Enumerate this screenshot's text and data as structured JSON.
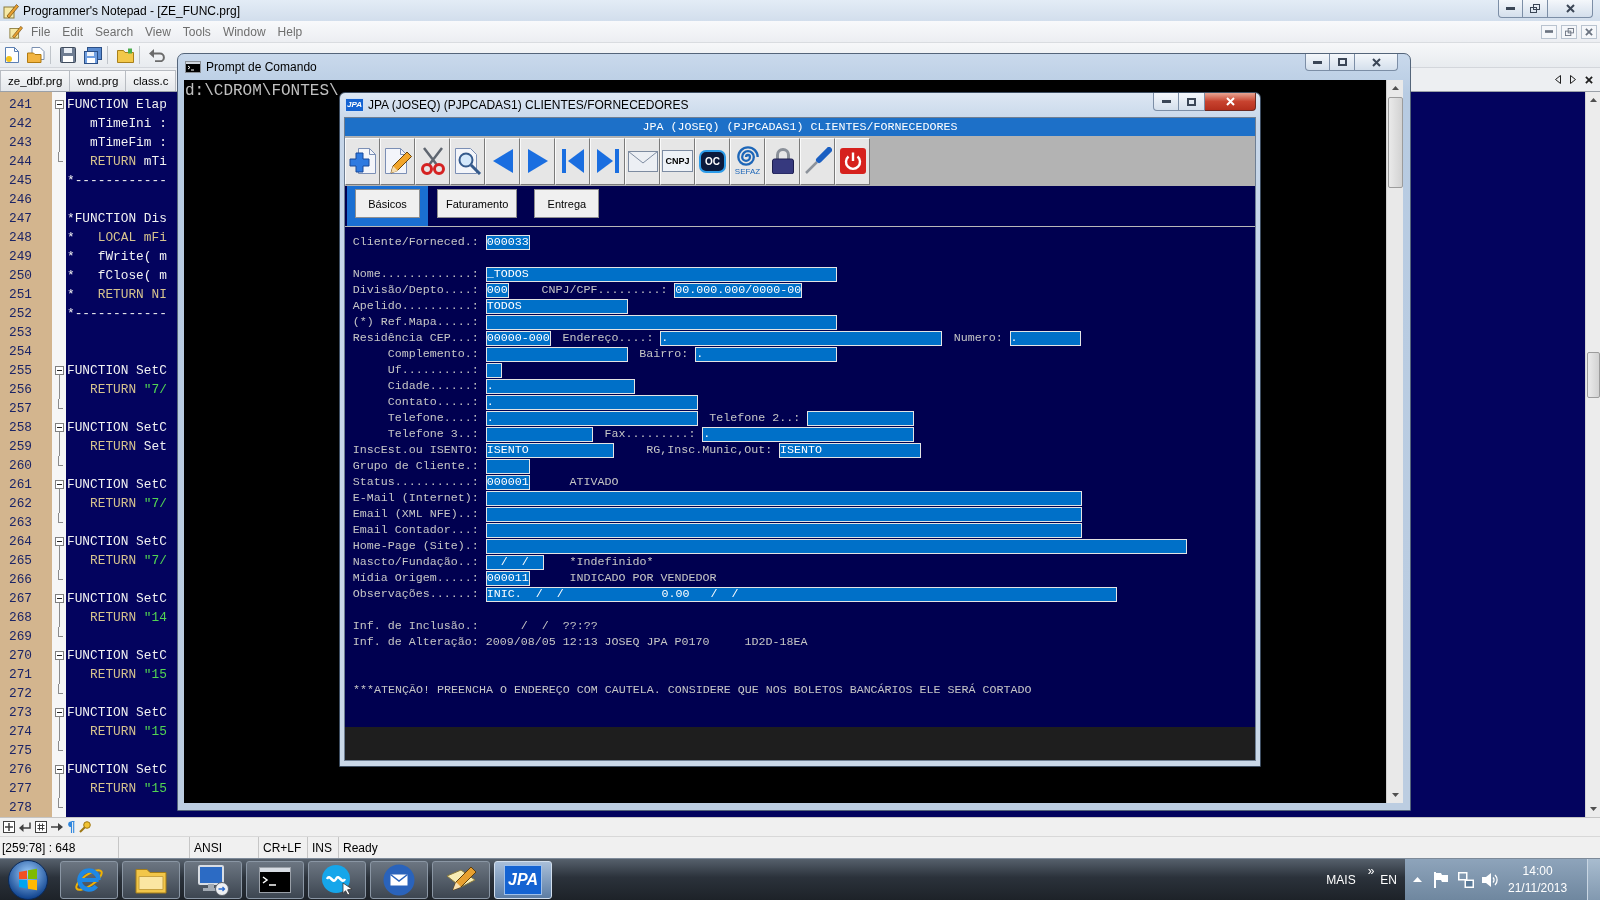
{
  "editor": {
    "title": "Programmer's Notepad - [ZE_FUNC.prg]",
    "menu": [
      "File",
      "Edit",
      "Search",
      "View",
      "Tools",
      "Window",
      "Help"
    ],
    "tabs": [
      {
        "label": "ze_dbf.prg",
        "selected": false
      },
      {
        "label": "wnd.prg",
        "selected": false
      },
      {
        "label": "class.c",
        "selected": false
      }
    ],
    "lines": [
      {
        "number": "241",
        "expanded": true,
        "tokens": [
          {
            "kind": "plain",
            "text": "FUNCTION Elap"
          }
        ],
        "children": [
          {
            "number": "242",
            "tokens": [
              {
                "kind": "plain",
                "text": "   mTimeIni :"
              }
            ]
          },
          {
            "number": "243",
            "tokens": [
              {
                "kind": "plain",
                "text": "   mTimeFim :"
              }
            ]
          },
          {
            "number": "244",
            "tokens": [
              {
                "kind": "keyword",
                "text": "   RETURN"
              },
              {
                "kind": "plain",
                "text": " mTi"
              }
            ]
          }
        ]
      },
      {
        "number": "245",
        "tokens": [
          {
            "kind": "plain",
            "text": "*------------"
          }
        ]
      },
      {
        "number": "246"
      },
      {
        "number": "247",
        "tokens": [
          {
            "kind": "plain",
            "text": "*FUNCTION Dis"
          }
        ]
      },
      {
        "number": "248",
        "tokens": [
          {
            "kind": "plain",
            "text": "*   "
          },
          {
            "kind": "keyword",
            "text": "LOCAL mFi"
          }
        ]
      },
      {
        "number": "249",
        "tokens": [
          {
            "kind": "plain",
            "text": "*   fWrite( m"
          }
        ]
      },
      {
        "number": "250",
        "tokens": [
          {
            "kind": "plain",
            "text": "*   fClose( m"
          }
        ]
      },
      {
        "number": "251",
        "tokens": [
          {
            "kind": "plain",
            "text": "*   "
          },
          {
            "kind": "keyword",
            "text": "RETURN NI"
          }
        ]
      },
      {
        "number": "252",
        "tokens": [
          {
            "kind": "plain",
            "text": "*------------"
          }
        ]
      },
      {
        "number": "253"
      },
      {
        "number": "254"
      },
      {
        "number": "255",
        "expanded": true,
        "tokens": [
          {
            "kind": "plain",
            "text": "FUNCTION SetC"
          }
        ],
        "children": [
          {
            "number": "256",
            "tokens": [
              {
                "kind": "keyword",
                "text": "   RETURN"
              },
              {
                "kind": "string",
                "text": " \"7/"
              }
            ]
          },
          {
            "number": "257"
          }
        ]
      },
      {
        "number": "258",
        "expanded": true,
        "tokens": [
          {
            "kind": "plain",
            "text": "FUNCTION SetC"
          }
        ],
        "children": [
          {
            "number": "259",
            "tokens": [
              {
                "kind": "keyword",
                "text": "   RETURN"
              },
              {
                "kind": "plain",
                "text": " Set"
              }
            ]
          },
          {
            "number": "260"
          }
        ]
      },
      {
        "number": "261",
        "expanded": true,
        "tokens": [
          {
            "kind": "plain",
            "text": "FUNCTION SetC"
          }
        ],
        "children": [
          {
            "number": "262",
            "tokens": [
              {
                "kind": "keyword",
                "text": "   RETURN"
              },
              {
                "kind": "string",
                "text": " \"7/"
              }
            ]
          },
          {
            "number": "263"
          }
        ]
      },
      {
        "number": "264",
        "expanded": true,
        "tokens": [
          {
            "kind": "plain",
            "text": "FUNCTION SetC"
          }
        ],
        "children": [
          {
            "number": "265",
            "tokens": [
              {
                "kind": "keyword",
                "text": "   RETURN"
              },
              {
                "kind": "string",
                "text": " \"7/"
              }
            ]
          },
          {
            "number": "266"
          }
        ]
      },
      {
        "number": "267",
        "expanded": true,
        "tokens": [
          {
            "kind": "plain",
            "text": "FUNCTION SetC"
          }
        ],
        "children": [
          {
            "number": "268",
            "tokens": [
              {
                "kind": "keyword",
                "text": "   RETURN"
              },
              {
                "kind": "string",
                "text": " \"14"
              }
            ]
          },
          {
            "number": "269"
          }
        ]
      },
      {
        "number": "270",
        "expanded": true,
        "tokens": [
          {
            "kind": "plain",
            "text": "FUNCTION SetC"
          }
        ],
        "children": [
          {
            "number": "271",
            "tokens": [
              {
                "kind": "keyword",
                "text": "   RETURN"
              },
              {
                "kind": "string",
                "text": " \"15"
              }
            ]
          },
          {
            "number": "272"
          }
        ]
      },
      {
        "number": "273",
        "expanded": true,
        "tokens": [
          {
            "kind": "plain",
            "text": "FUNCTION SetC"
          }
        ],
        "children": [
          {
            "number": "274",
            "tokens": [
              {
                "kind": "keyword",
                "text": "   RETURN"
              },
              {
                "kind": "string",
                "text": " \"15"
              }
            ]
          },
          {
            "number": "275"
          }
        ]
      },
      {
        "number": "276",
        "expanded": true,
        "tokens": [
          {
            "kind": "plain",
            "text": "FUNCTION SetC"
          }
        ],
        "children": [
          {
            "number": "277",
            "tokens": [
              {
                "kind": "keyword",
                "text": "   RETURN"
              },
              {
                "kind": "string",
                "text": " \"15"
              }
            ]
          },
          {
            "number": "278"
          }
        ]
      }
    ],
    "status_bar": {
      "position": "[259:78] : 648",
      "encoding": "ANSI",
      "line_ending": "CR+LF",
      "mode": "INS",
      "state": "Ready"
    }
  },
  "command_prompt": {
    "title": "Prompt de Comando",
    "lines": [
      "d:\\CDROM\\FONTES\\"
    ]
  },
  "jpa_window": {
    "icon_label": "JPA",
    "title": "JPA (JOSEQ) (PJPCADAS1) CLIENTES/FORNECEDORES",
    "header": "JPA (JOSEQ) (PJPCADAS1) CLIENTES/FORNECEDORES",
    "toolbar": [
      {
        "kind": "add"
      },
      {
        "kind": "edit"
      },
      {
        "kind": "cut"
      },
      {
        "kind": "preview"
      },
      {
        "kind": "previous"
      },
      {
        "kind": "next"
      },
      {
        "kind": "first"
      },
      {
        "kind": "last"
      },
      {
        "kind": "mail"
      },
      {
        "kind": "card",
        "label": "CNPJ"
      },
      {
        "kind": "bubble",
        "label": "OC"
      },
      {
        "kind": "swirl",
        "label": "SEFAZ"
      },
      {
        "kind": "lock"
      },
      {
        "kind": "tool"
      },
      {
        "kind": "power"
      }
    ],
    "tabs": [
      {
        "label": "Básicos",
        "selected": true
      },
      {
        "label": "Faturamento",
        "selected": false
      },
      {
        "label": "Entrega",
        "selected": false
      }
    ],
    "form": [
      {
        "rows": [
          {
            "label": "Cliente/Forneced.:",
            "items": [
              {
                "kind": "field",
                "value": "000033"
              }
            ]
          }
        ]
      },
      {
        "rows": [
          {
            "label": "Nome.............:",
            "items": [
              {
                "kind": "field",
                "value": "_TODOS"
              }
            ]
          },
          {
            "label": "Divisão/Depto....:",
            "items": [
              {
                "kind": "field",
                "value": "000"
              },
              {
                "kind": "text",
                "text": "CNPJ/CPF.........:"
              },
              {
                "kind": "field",
                "value": "00.000.000/0000-00"
              }
            ]
          },
          {
            "label": "Apelido..........:",
            "items": [
              {
                "kind": "field",
                "value": "TODOS"
              }
            ]
          },
          {
            "label": "(*) Ref.Mapa.....:",
            "items": [
              {
                "kind": "field"
              }
            ]
          },
          {
            "label": "Residência CEP...:",
            "items": [
              {
                "kind": "field",
                "value": "00000-000"
              },
              {
                "kind": "text",
                "text": "Endereço....:"
              },
              {
                "kind": "field",
                "value": "."
              },
              {
                "kind": "text",
                "text": "Numero:"
              },
              {
                "kind": "field",
                "value": "."
              }
            ]
          },
          {
            "label": "Complemento.:",
            "items": [
              {
                "kind": "field"
              },
              {
                "kind": "text",
                "text": "Bairro:"
              },
              {
                "kind": "field",
                "value": "."
              }
            ]
          },
          {
            "label": "Uf..........:",
            "items": [
              {
                "kind": "field"
              }
            ]
          },
          {
            "label": "Cidade......:",
            "items": [
              {
                "kind": "field",
                "value": "."
              }
            ]
          },
          {
            "label": "Contato.....:",
            "items": [
              {
                "kind": "field",
                "value": "."
              }
            ]
          },
          {
            "label": "Telefone....:",
            "items": [
              {
                "kind": "field",
                "value": "."
              },
              {
                "kind": "text",
                "text": "Telefone 2..:"
              },
              {
                "kind": "field"
              }
            ]
          },
          {
            "label": "Telefone 3..:",
            "items": [
              {
                "kind": "field"
              },
              {
                "kind": "text",
                "text": "Fax.........:"
              },
              {
                "kind": "field",
                "value": "."
              }
            ]
          },
          {
            "label": "InscEst.ou ISENTO:",
            "items": [
              {
                "kind": "field",
                "value": "ISENTO"
              },
              {
                "kind": "text",
                "text": "RG,Insc.Munic,Out:"
              },
              {
                "kind": "field",
                "value": "ISENTO"
              }
            ]
          },
          {
            "label": "Grupo de Cliente.:",
            "items": [
              {
                "kind": "field"
              }
            ]
          },
          {
            "label": "Status...........:",
            "items": [
              {
                "kind": "field",
                "value": "000001"
              },
              {
                "kind": "text",
                "text": "ATIVADO"
              }
            ]
          },
          {
            "label": "E-Mail (Internet):",
            "items": [
              {
                "kind": "field"
              }
            ]
          },
          {
            "label": "Email (XML NFE)..:",
            "items": [
              {
                "kind": "field"
              }
            ]
          },
          {
            "label": "Email Contador...:",
            "items": [
              {
                "kind": "field"
              }
            ]
          },
          {
            "label": "Home-Page (Site).:",
            "items": [
              {
                "kind": "field"
              }
            ]
          },
          {
            "label": "Nascto/Fundação..:",
            "items": [
              {
                "kind": "field",
                "value": "  /  /"
              },
              {
                "kind": "text",
                "text": "*Indefinido*"
              }
            ]
          },
          {
            "label": "Mídia Origem.....:",
            "items": [
              {
                "kind": "field",
                "value": "000011"
              },
              {
                "kind": "text",
                "text": "INDICADO POR VENDEDOR"
              }
            ]
          },
          {
            "label": "Observações......:",
            "items": [
              {
                "kind": "field",
                "value": "INIC.  /  /              0.00   /  /"
              }
            ]
          }
        ]
      },
      {
        "rows": [
          {
            "label": "Inf. de Inclusão.:",
            "items": [
              {
                "kind": "text",
                "text": "     /  /  ??:??"
              }
            ]
          },
          {
            "label": "Inf. de Alteração:",
            "items": [
              {
                "kind": "text",
                "text": "2009/08/05 12:13 JOSEQ JPA P0170     1D2D-18EA"
              }
            ]
          }
        ]
      }
    ],
    "notice": "***ATENÇÃO! PREENCHA O ENDEREÇO COM CAUTELA. CONSIDERE QUE NOS BOLETOS BANCÁRIOS ELE SERÁ CORTADO"
  },
  "taskbar": {
    "items": [
      {
        "kind": "browser",
        "selected": false
      },
      {
        "kind": "files",
        "selected": false
      },
      {
        "kind": "remote",
        "selected": false
      },
      {
        "kind": "terminal",
        "selected": false
      },
      {
        "kind": "messenger",
        "selected": false
      },
      {
        "kind": "mail",
        "selected": false
      },
      {
        "kind": "editor",
        "selected": false
      },
      {
        "kind": "app",
        "label": "JPA",
        "selected": true
      }
    ],
    "tray": {
      "toolbar": "MAIS",
      "overflow": "»",
      "language": "EN",
      "time": "14:00",
      "date": "21/11/2013"
    }
  }
}
